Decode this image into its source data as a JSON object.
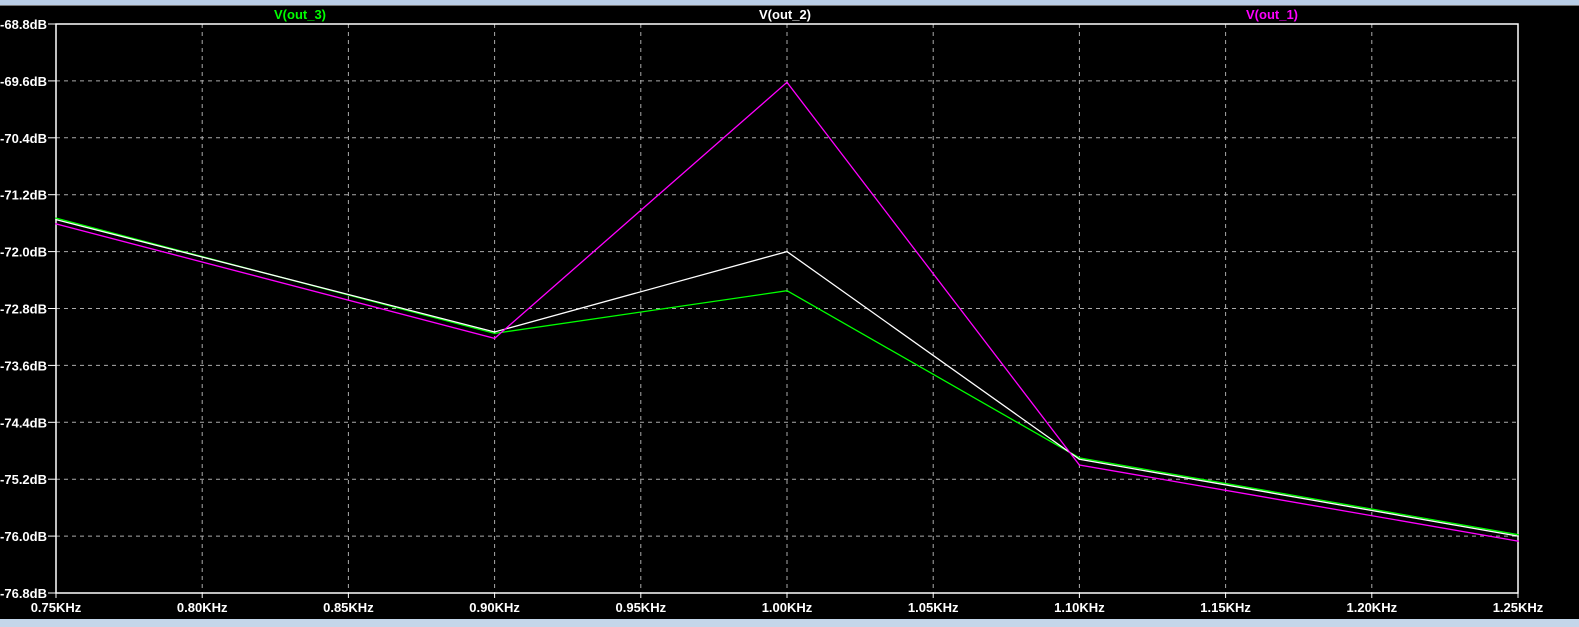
{
  "chart_data": {
    "type": "line",
    "title": "",
    "xlabel": "",
    "ylabel": "",
    "xlim": [
      0.75,
      1.25
    ],
    "ylim": [
      -76.8,
      -68.8
    ],
    "grid": true,
    "x_ticks": [
      0.75,
      0.8,
      0.85,
      0.9,
      0.95,
      1.0,
      1.05,
      1.1,
      1.15,
      1.2,
      1.25
    ],
    "x_tick_labels": [
      "0.75KHz",
      "0.80KHz",
      "0.85KHz",
      "0.90KHz",
      "0.95KHz",
      "1.00KHz",
      "1.05KHz",
      "1.10KHz",
      "1.15KHz",
      "1.20KHz",
      "1.25KHz"
    ],
    "y_ticks": [
      -68.8,
      -69.6,
      -70.4,
      -71.2,
      -72.0,
      -72.8,
      -73.6,
      -74.4,
      -75.2,
      -76.0,
      -76.8
    ],
    "y_tick_labels": [
      "-68.8dB",
      "-69.6dB",
      "-70.4dB",
      "-71.2dB",
      "-72.0dB",
      "-72.8dB",
      "-73.6dB",
      "-74.4dB",
      "-75.2dB",
      "-76.0dB",
      "-76.8dB"
    ],
    "x": [
      0.75,
      0.9,
      1.0,
      1.1,
      1.25
    ],
    "series": [
      {
        "name": "V(out_3)",
        "color": "#00ff00",
        "values": [
          -71.53,
          -73.15,
          -72.55,
          -74.9,
          -75.98
        ]
      },
      {
        "name": "V(out_2)",
        "color": "#ffffff",
        "values": [
          -71.55,
          -73.13,
          -72.0,
          -74.92,
          -76.0
        ]
      },
      {
        "name": "V(out_1)",
        "color": "#ff00ff",
        "values": [
          -71.61,
          -73.22,
          -69.62,
          -75.0,
          -76.07
        ]
      }
    ],
    "legend_placement": "top"
  }
}
